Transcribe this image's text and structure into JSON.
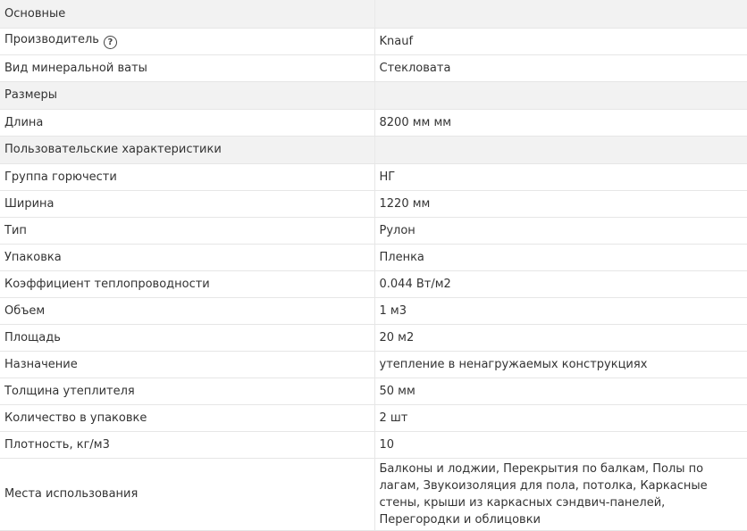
{
  "sections": {
    "main": "Основные",
    "sizes": "Размеры",
    "user": "Пользовательские характеристики"
  },
  "rows": {
    "manufacturer": {
      "label": "Производитель",
      "value": "Knauf",
      "icon": "question-circle-icon",
      "icon_glyph": "?"
    },
    "wool_type": {
      "label": "Вид минеральной ваты",
      "value": "Стекловата"
    },
    "length": {
      "label": "Длина",
      "value": "8200 мм мм"
    },
    "flammability": {
      "label": "Группа горючести",
      "value": "НГ"
    },
    "width": {
      "label": "Ширина",
      "value": "1220 мм"
    },
    "type": {
      "label": "Тип",
      "value": "Рулон"
    },
    "packaging": {
      "label": "Упаковка",
      "value": "Пленка"
    },
    "conductivity": {
      "label": "Коэффициент теплопроводности",
      "value": "0.044 Вт/м2"
    },
    "volume": {
      "label": "Объем",
      "value": "1 м3"
    },
    "area": {
      "label": "Площадь",
      "value": "20 м2"
    },
    "purpose": {
      "label": "Назначение",
      "value": "утепление в ненагружаемых конструкциях"
    },
    "thickness": {
      "label": "Толщина утеплителя",
      "value": "50 мм"
    },
    "quantity": {
      "label": "Количество в упаковке",
      "value": "2 шт"
    },
    "density": {
      "label": "Плотность, кг/м3",
      "value": "10"
    },
    "places": {
      "label": "Места использования",
      "value": "Балконы и лоджии, Перекрытия по балкам, Полы по лагам, Звукоизоляция для пола, потолка, Каркасные стены, крыши из каркасных сэндвич-панелей, Перегородки и облицовки"
    }
  }
}
